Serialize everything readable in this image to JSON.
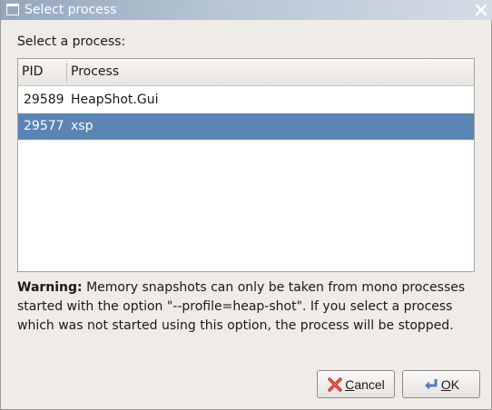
{
  "window": {
    "title": "Select process"
  },
  "prompt": "Select a process:",
  "list": {
    "columns": [
      "PID",
      "Process"
    ],
    "rows": [
      {
        "pid": "29589",
        "process": "HeapShot.Gui",
        "selected": false
      },
      {
        "pid": "29577",
        "process": "xsp",
        "selected": true
      }
    ]
  },
  "warning": {
    "label": "Warning:",
    "text": " Memory snapshots can only be taken from mono processes started with the option \"--profile=heap-shot\". If you select a process which was not started using this option, the process will be stopped."
  },
  "buttons": {
    "cancel_label": "Cancel",
    "ok_label": "OK"
  },
  "icons": {
    "title": "window-icon",
    "close": "close-icon",
    "cancel": "cancel-x-icon",
    "ok": "ok-arrow-icon"
  },
  "colors": {
    "selection": "#5a84b4",
    "window_bg": "#efebe7",
    "cancel_icon": "#d02d1e",
    "ok_icon": "#4f7fc0"
  }
}
